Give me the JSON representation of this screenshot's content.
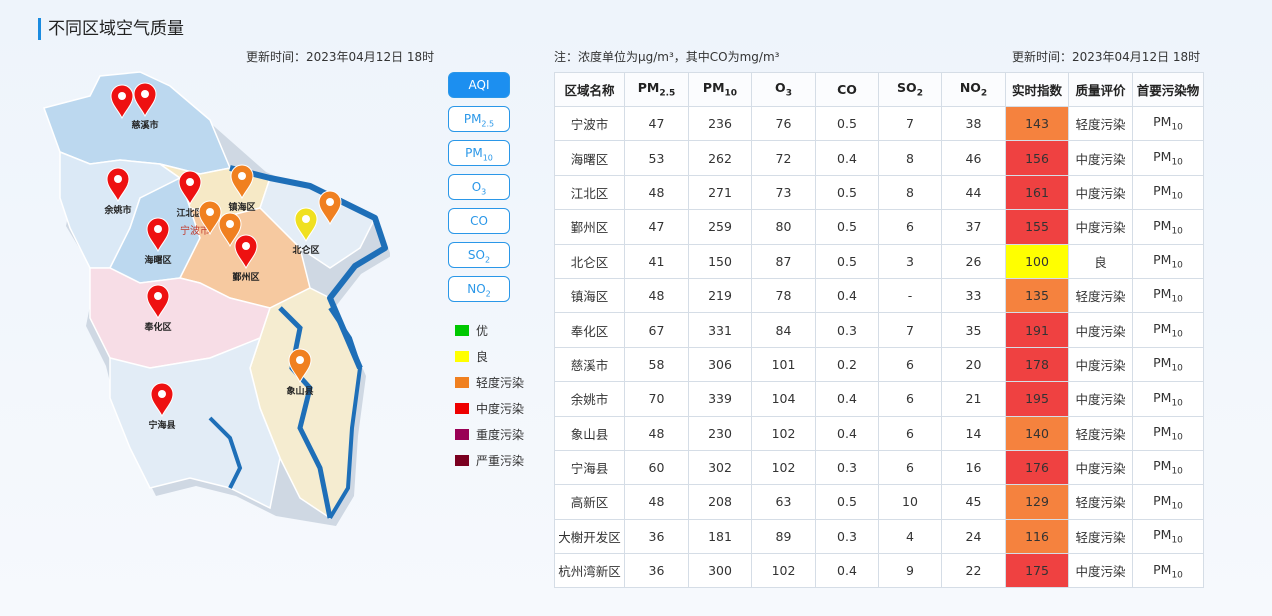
{
  "page": {
    "title": "不同区域空气质量",
    "update_left": "更新时间：2023年04月12日 18时",
    "note": "注：浓度单位为μg/m³，其中CO为mg/m³",
    "update_right": "更新时间：2023年04月12日 18时"
  },
  "pollutant_buttons": [
    {
      "base": "AQI",
      "sub": "",
      "active": true
    },
    {
      "base": "PM",
      "sub": "2.5",
      "active": false
    },
    {
      "base": "PM",
      "sub": "10",
      "active": false
    },
    {
      "base": "O",
      "sub": "3",
      "active": false
    },
    {
      "base": "CO",
      "sub": "",
      "active": false
    },
    {
      "base": "SO",
      "sub": "2",
      "active": false
    },
    {
      "base": "NO",
      "sub": "2",
      "active": false
    }
  ],
  "legend": [
    {
      "label": "优",
      "color": "#00c800"
    },
    {
      "label": "良",
      "color": "#ffff00"
    },
    {
      "label": "轻度污染",
      "color": "#f08020"
    },
    {
      "label": "中度污染",
      "color": "#ee0000"
    },
    {
      "label": "重度污染",
      "color": "#990055"
    },
    {
      "label": "严重污染",
      "color": "#7a0020"
    }
  ],
  "map": {
    "pins": [
      {
        "label": "慈溪市",
        "color": "#ee1111"
      },
      {
        "label": "",
        "color": "#ee1111"
      },
      {
        "label": "余姚市",
        "color": "#ee1111"
      },
      {
        "label": "江北区",
        "color": "#ee1111"
      },
      {
        "label": "镇海区",
        "color": "#f08020"
      },
      {
        "label": "北仑区",
        "color": "#f0e020"
      },
      {
        "label": "",
        "color": "#f08020"
      },
      {
        "label": "",
        "color": "#f08020"
      },
      {
        "label": "",
        "color": "#f08020"
      },
      {
        "label": "海曙区",
        "color": "#ee1111"
      },
      {
        "label": "鄞州区",
        "color": "#ee1111"
      },
      {
        "label": "奉化区",
        "color": "#ee1111"
      },
      {
        "label": "象山县",
        "color": "#f08020"
      },
      {
        "label": "宁海县",
        "color": "#ee1111"
      }
    ],
    "city_label": "宁波市"
  },
  "table": {
    "headers": [
      {
        "base": "区域名称",
        "sub": ""
      },
      {
        "base": "PM",
        "sub": "2.5"
      },
      {
        "base": "PM",
        "sub": "10"
      },
      {
        "base": "O",
        "sub": "3"
      },
      {
        "base": "CO",
        "sub": ""
      },
      {
        "base": "SO",
        "sub": "2"
      },
      {
        "base": "NO",
        "sub": "2"
      },
      {
        "base": "实时指数",
        "sub": ""
      },
      {
        "base": "质量评价",
        "sub": ""
      },
      {
        "base": "首要污染物",
        "sub": ""
      }
    ],
    "rows": [
      {
        "name": "宁波市",
        "pm25": "47",
        "pm10": "236",
        "o3": "76",
        "co": "0.5",
        "so2": "7",
        "no2": "38",
        "aqi": "143",
        "aqi_color": "#f5823e",
        "level": "轻度污染",
        "primary": "PM",
        "primary_sub": "10"
      },
      {
        "name": "海曙区",
        "pm25": "53",
        "pm10": "262",
        "o3": "72",
        "co": "0.4",
        "so2": "8",
        "no2": "46",
        "aqi": "156",
        "aqi_color": "#ef4141",
        "level": "中度污染",
        "primary": "PM",
        "primary_sub": "10"
      },
      {
        "name": "江北区",
        "pm25": "48",
        "pm10": "271",
        "o3": "73",
        "co": "0.5",
        "so2": "8",
        "no2": "44",
        "aqi": "161",
        "aqi_color": "#ef4141",
        "level": "中度污染",
        "primary": "PM",
        "primary_sub": "10"
      },
      {
        "name": "鄞州区",
        "pm25": "47",
        "pm10": "259",
        "o3": "80",
        "co": "0.5",
        "so2": "6",
        "no2": "37",
        "aqi": "155",
        "aqi_color": "#ef4141",
        "level": "中度污染",
        "primary": "PM",
        "primary_sub": "10"
      },
      {
        "name": "北仑区",
        "pm25": "41",
        "pm10": "150",
        "o3": "87",
        "co": "0.5",
        "so2": "3",
        "no2": "26",
        "aqi": "100",
        "aqi_color": "#ffff00",
        "level": "良",
        "primary": "PM",
        "primary_sub": "10"
      },
      {
        "name": "镇海区",
        "pm25": "48",
        "pm10": "219",
        "o3": "78",
        "co": "0.4",
        "so2": "-",
        "no2": "33",
        "aqi": "135",
        "aqi_color": "#f5823e",
        "level": "轻度污染",
        "primary": "PM",
        "primary_sub": "10"
      },
      {
        "name": "奉化区",
        "pm25": "67",
        "pm10": "331",
        "o3": "84",
        "co": "0.3",
        "so2": "7",
        "no2": "35",
        "aqi": "191",
        "aqi_color": "#ef4141",
        "level": "中度污染",
        "primary": "PM",
        "primary_sub": "10"
      },
      {
        "name": "慈溪市",
        "pm25": "58",
        "pm10": "306",
        "o3": "101",
        "co": "0.2",
        "so2": "6",
        "no2": "20",
        "aqi": "178",
        "aqi_color": "#ef4141",
        "level": "中度污染",
        "primary": "PM",
        "primary_sub": "10"
      },
      {
        "name": "余姚市",
        "pm25": "70",
        "pm10": "339",
        "o3": "104",
        "co": "0.4",
        "so2": "6",
        "no2": "21",
        "aqi": "195",
        "aqi_color": "#ef4141",
        "level": "中度污染",
        "primary": "PM",
        "primary_sub": "10"
      },
      {
        "name": "象山县",
        "pm25": "48",
        "pm10": "230",
        "o3": "102",
        "co": "0.4",
        "so2": "6",
        "no2": "14",
        "aqi": "140",
        "aqi_color": "#f5823e",
        "level": "轻度污染",
        "primary": "PM",
        "primary_sub": "10"
      },
      {
        "name": "宁海县",
        "pm25": "60",
        "pm10": "302",
        "o3": "102",
        "co": "0.3",
        "so2": "6",
        "no2": "16",
        "aqi": "176",
        "aqi_color": "#ef4141",
        "level": "中度污染",
        "primary": "PM",
        "primary_sub": "10"
      },
      {
        "name": "高新区",
        "pm25": "48",
        "pm10": "208",
        "o3": "63",
        "co": "0.5",
        "so2": "10",
        "no2": "45",
        "aqi": "129",
        "aqi_color": "#f5823e",
        "level": "轻度污染",
        "primary": "PM",
        "primary_sub": "10"
      },
      {
        "name": "大榭开发区",
        "pm25": "36",
        "pm10": "181",
        "o3": "89",
        "co": "0.3",
        "so2": "4",
        "no2": "24",
        "aqi": "116",
        "aqi_color": "#f5823e",
        "level": "轻度污染",
        "primary": "PM",
        "primary_sub": "10"
      },
      {
        "name": "杭州湾新区",
        "pm25": "36",
        "pm10": "300",
        "o3": "102",
        "co": "0.4",
        "so2": "9",
        "no2": "22",
        "aqi": "175",
        "aqi_color": "#ef4141",
        "level": "中度污染",
        "primary": "PM",
        "primary_sub": "10"
      }
    ]
  }
}
